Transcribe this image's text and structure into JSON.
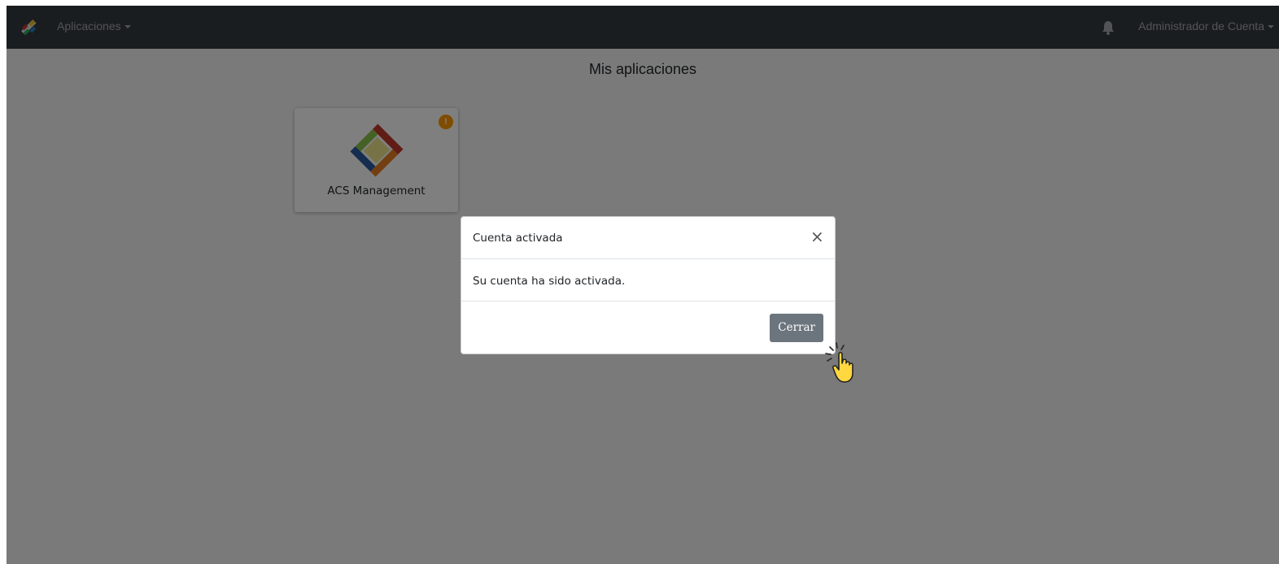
{
  "navbar": {
    "apps_menu_label": "Aplicaciones",
    "user_menu_label": "Administrador de Cuenta",
    "logo_icon": "app-logo-icon",
    "bell_icon": "bell-icon"
  },
  "page": {
    "title": "Mis aplicaciones"
  },
  "apps": [
    {
      "name": "ACS Management",
      "badge": "!"
    }
  ],
  "modal": {
    "title": "Cuenta activada",
    "close_symbol": "×",
    "message": "Su cuenta ha sido activada.",
    "close_button_label": "Cerrar"
  },
  "colors": {
    "navbar": "#343a40",
    "badge": "#ff9800",
    "secondary_button": "#6c757d"
  }
}
